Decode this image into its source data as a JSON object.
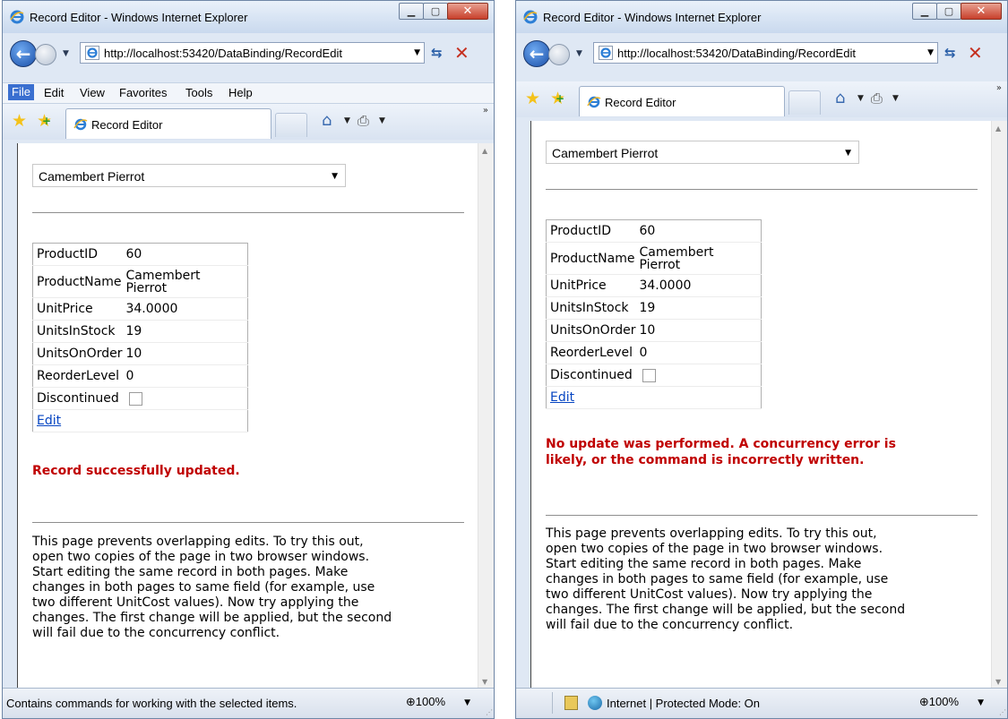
{
  "windows": [
    {
      "window_title": "Record Editor - Windows Internet Explorer",
      "address_url": "http://localhost:53420/DataBinding/RecordEdit",
      "menu": [
        "File",
        "Edit",
        "View",
        "Favorites",
        "Tools",
        "Help"
      ],
      "tab_label": "Record Editor",
      "dropdown_value": "Camembert Pierrot",
      "fields": [
        {
          "label": "ProductID",
          "value": "60"
        },
        {
          "label": "ProductName",
          "value_line1": "Camembert",
          "value_line2": "Pierrot"
        },
        {
          "label": "UnitPrice",
          "value": "34.0000"
        },
        {
          "label": "UnitsInStock",
          "value": "19"
        },
        {
          "label": "UnitsOnOrder",
          "value": "10"
        },
        {
          "label": "ReorderLevel",
          "value": "0"
        },
        {
          "label": "Discontinued",
          "checked": false
        }
      ],
      "edit_link": "Edit",
      "message": "Record successfully updated.",
      "paragraph_lines": [
        "This page prevents overlapping edits. To try this out,",
        "open two copies of the page in two browser windows.",
        "Start editing the same record in both pages. Make",
        "changes in both pages to same field (for example, use",
        "two different UnitCost values). Now try applying the",
        "changes. The first change will be applied, but the second",
        "will fail due to the concurrency conflict."
      ],
      "status_text": "Contains commands for working with the selected items.",
      "zoom": "100%"
    },
    {
      "window_title": "Record Editor - Windows Internet Explorer",
      "address_url": "http://localhost:53420/DataBinding/RecordEdit",
      "tab_label": "Record Editor",
      "dropdown_value": "Camembert Pierrot",
      "fields": [
        {
          "label": "ProductID",
          "value": "60"
        },
        {
          "label": "ProductName",
          "value_line1": "Camembert",
          "value_line2": "Pierrot"
        },
        {
          "label": "UnitPrice",
          "value": "34.0000"
        },
        {
          "label": "UnitsInStock",
          "value": "19"
        },
        {
          "label": "UnitsOnOrder",
          "value": "10"
        },
        {
          "label": "ReorderLevel",
          "value": "0"
        },
        {
          "label": "Discontinued",
          "checked": false
        }
      ],
      "edit_link": "Edit",
      "message_lines": [
        "No update was performed. A concurrency error is",
        "likely, or the command is incorrectly written."
      ],
      "paragraph_lines": [
        "This page prevents overlapping edits. To try this out,",
        "open two copies of the page in two browser windows.",
        "Start editing the same record in both pages. Make",
        "changes in both pages to same field (for example, use",
        "two different UnitCost values). Now try applying the",
        "changes. The first change will be applied, but the second",
        "will fail due to the concurrency conflict."
      ],
      "status_zone": "Internet | Protected Mode: On",
      "zoom": "100%"
    }
  ],
  "colors": {
    "message": "#c00000",
    "link": "#0645c2",
    "menu_highlight": "#3a6fd0"
  },
  "icons": [
    "ie-logo-icon",
    "back-arrow-icon",
    "forward-arrow-icon",
    "refresh-icon",
    "stop-icon",
    "favorites-star-icon",
    "add-favorites-icon",
    "home-icon",
    "print-icon",
    "zoom-icon",
    "security-shield-icon",
    "internet-globe-icon",
    "resize-grip-icon"
  ]
}
